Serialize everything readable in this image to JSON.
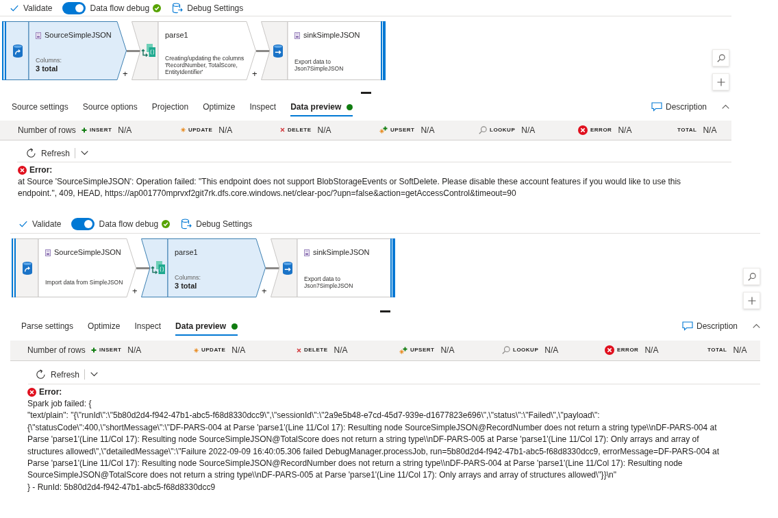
{
  "panels": [
    {
      "toolbar": {
        "validate": "Validate",
        "debug": {
          "label": "Data flow debug",
          "on": true
        },
        "debug_settings": "Debug Settings"
      },
      "nodes": [
        {
          "kind": "source",
          "title": "SourceSimpleJSON",
          "selected": true,
          "columns_label": "Columns:",
          "columns_total": "3 total",
          "add": "+"
        },
        {
          "kind": "parse",
          "title": "parse1",
          "selected": false,
          "description": "Creating/updating the columns 'RecordNumber, TotalScore, EntityIdentifier'",
          "add": "+"
        },
        {
          "kind": "sink",
          "title": "sinkSimpleJSON",
          "selected": false,
          "description": "Export data to Json7SimpleJSON"
        }
      ],
      "tabs": [
        {
          "label": "Source settings",
          "selected": false,
          "dot": false
        },
        {
          "label": "Source options",
          "selected": false,
          "dot": false
        },
        {
          "label": "Projection",
          "selected": false,
          "dot": false
        },
        {
          "label": "Optimize",
          "selected": false,
          "dot": false
        },
        {
          "label": "Inspect",
          "selected": false,
          "dot": false
        },
        {
          "label": "Data preview",
          "selected": true,
          "dot": true
        }
      ],
      "description_button": "Description",
      "row_counts": {
        "label": "Number of rows",
        "items": [
          {
            "kind": "insert",
            "label": "INSERT",
            "value": "N/A"
          },
          {
            "kind": "update",
            "label": "UPDATE",
            "value": "N/A"
          },
          {
            "kind": "delete",
            "label": "DELETE",
            "value": "N/A"
          },
          {
            "kind": "upsert",
            "label": "UPSERT",
            "value": "N/A"
          },
          {
            "kind": "lookup",
            "label": "LOOKUP",
            "value": "N/A"
          },
          {
            "kind": "error",
            "label": "ERROR",
            "value": "N/A"
          },
          {
            "kind": "total",
            "label": "TOTAL",
            "value": "N/A"
          }
        ]
      },
      "refresh": "Refresh",
      "error": {
        "title": "Error:",
        "lines": [
          "at Source 'SourceSimpleJSON': Operation failed: \"This endpoint does not support BlobStorageEvents or SoftDelete. Please disable these account features if you would like to use this",
          "endpoint.\", 409, HEAD, https://ap001770mprvxf2git7rk.dfs.core.windows.net/clear-poc/?upn=false&action=getAccessControl&timeout=90"
        ]
      }
    },
    {
      "toolbar": {
        "validate": "Validate",
        "debug": {
          "label": "Data flow debug",
          "on": true
        },
        "debug_settings": "Debug Settings"
      },
      "nodes": [
        {
          "kind": "source",
          "title": "SourceSimpleJSON",
          "selected": false,
          "description": "Import data from SimpleJSON",
          "add": "+"
        },
        {
          "kind": "parse",
          "title": "parse1",
          "selected": true,
          "columns_label": "Columns:",
          "columns_total": "3 total",
          "add": "+"
        },
        {
          "kind": "sink",
          "title": "sinkSimpleJSON",
          "selected": false,
          "description": "Export data to Json7SimpleJSON"
        }
      ],
      "tabs": [
        {
          "label": "Parse settings",
          "selected": false,
          "dot": false
        },
        {
          "label": "Optimize",
          "selected": false,
          "dot": false
        },
        {
          "label": "Inspect",
          "selected": false,
          "dot": false
        },
        {
          "label": "Data preview",
          "selected": true,
          "dot": true
        }
      ],
      "description_button": "Description",
      "row_counts": {
        "label": "Number of rows",
        "items": [
          {
            "kind": "insert",
            "label": "INSERT",
            "value": "N/A"
          },
          {
            "kind": "update",
            "label": "UPDATE",
            "value": "N/A"
          },
          {
            "kind": "delete",
            "label": "DELETE",
            "value": "N/A"
          },
          {
            "kind": "upsert",
            "label": "UPSERT",
            "value": "N/A"
          },
          {
            "kind": "lookup",
            "label": "LOOKUP",
            "value": "N/A"
          },
          {
            "kind": "error",
            "label": "ERROR",
            "value": "N/A"
          },
          {
            "kind": "total",
            "label": "TOTAL",
            "value": "N/A"
          }
        ]
      },
      "refresh": "Refresh",
      "error": {
        "title": "Error:",
        "lines": [
          "Spark job failed: {",
          "\"text/plain\": \"{\\\"runId\\\":\\\"5b80d2d4-f942-47b1-abc5-f68d8330dcc9\\\",\\\"sessionId\\\":\\\"2a9e5b48-e7cd-45d7-939e-d1677823e696\\\",\\\"status\\\":\\\"Failed\\\",\\\"payload\\\":",
          "{\\\"statusCode\\\":400,\\\"shortMessage\\\":\\\"DF-PARS-004 at Parse 'parse1'(Line 11/Col 17): Resulting node SourceSimpleJSON@RecordNumber does not return a string type\\\\nDF-PARS-004 at",
          "Parse 'parse1'(Line 11/Col 17): Resulting node SourceSimpleJSON@TotalScore does not return a string type\\\\nDF-PARS-005 at Parse 'parse1'(Line 11/Col 17): Only arrays and array of",
          "structures allowed\\\",\\\"detailedMessage\\\":\\\"Failure 2022-09-09 16:40:05.306 failed DebugManager.processJob, run=5b80d2d4-f942-47b1-abc5-f68d8330dcc9, errorMessage=DF-PARS-004 at",
          "Parse 'parse1'(Line 11/Col 17): Resulting node SourceSimpleJSON@RecordNumber does not return a string type\\\\nDF-PARS-004 at Parse 'parse1'(Line 11/Col 17): Resulting node",
          "SourceSimpleJSON@TotalScore does not return a string type\\\\nDF-PARS-005 at Parse 'parse1'(Line 11/Col 17): Only arrays and array of structures allowed\\\"}}\\n\"",
          "} - RunId: 5b80d2d4-f942-47b1-abc5-f68d8330dcc9"
        ]
      }
    }
  ]
}
